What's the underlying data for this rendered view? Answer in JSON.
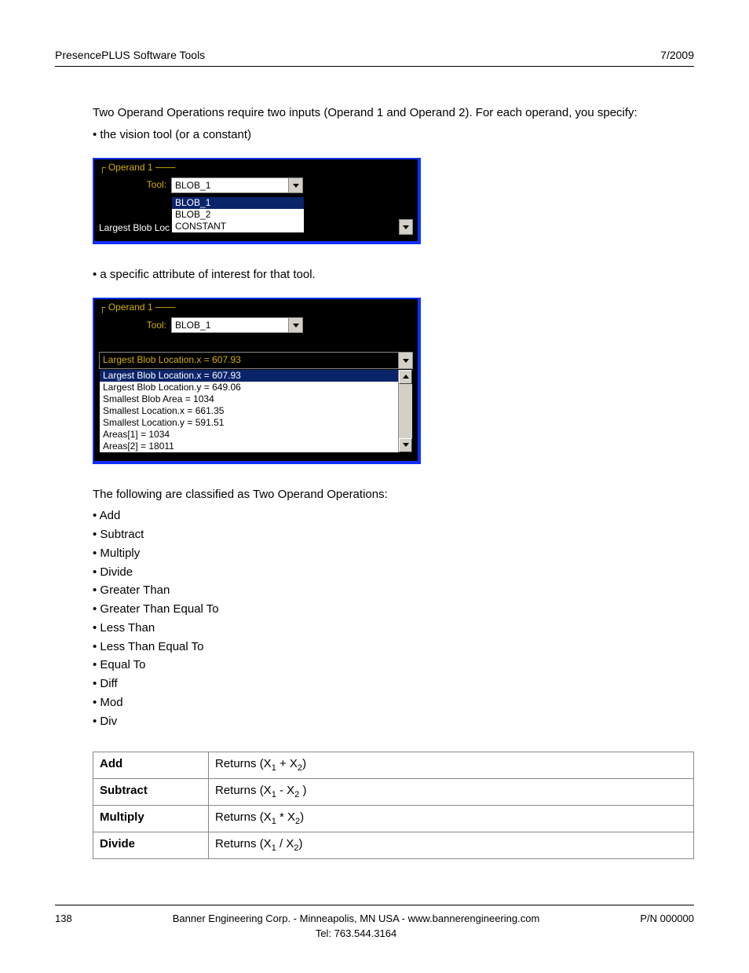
{
  "header": {
    "left": "PresencePLUS Software Tools",
    "right": "7/2009"
  },
  "intro": "Two Operand Operations require two inputs (Operand 1 and Operand 2). For each operand, you specify:",
  "bullet1": "• the vision tool (or a constant)",
  "panel1": {
    "legend": "Operand 1",
    "tool_label": "Tool:",
    "tool_value": "BLOB_1",
    "options": [
      "BLOB_1",
      "BLOB_2",
      "CONSTANT"
    ],
    "truncated": "Largest Blob Loc"
  },
  "bullet2": "• a specific attribute of interest for that tool.",
  "panel2": {
    "legend": "Operand 1",
    "tool_label": "Tool:",
    "tool_value": "BLOB_1",
    "attr_selected": "Largest Blob Location.x = 607.93",
    "attrs": [
      "Largest Blob Location.x = 607.93",
      "Largest Blob Location.y = 649.06",
      "Smallest Blob Area = 1034",
      "Smallest Location.x = 661.35",
      "Smallest Location.y = 591.51",
      "Areas[1] = 1034",
      "Areas[2] = 18011"
    ]
  },
  "classified_intro": "The following are classified as Two Operand Operations:",
  "ops_bullets": [
    "• Add",
    "• Subtract",
    "• Multiply",
    "• Divide",
    "• Greater Than",
    "• Greater Than Equal To",
    "• Less Than",
    "• Less Than Equal To",
    "• Equal To",
    "• Diff",
    "• Mod",
    "• Div"
  ],
  "table": [
    {
      "name": "Add",
      "desc_pre": "Returns (X",
      "s1": "1",
      "mid": " + X",
      "s2": "2",
      "desc_post": ")"
    },
    {
      "name": "Subtract",
      "desc_pre": "Returns (X",
      "s1": "1",
      "mid": " - X",
      "s2": "2",
      "desc_post": " )"
    },
    {
      "name": "Multiply",
      "desc_pre": "Returns (X",
      "s1": "1",
      "mid": " * X",
      "s2": "2",
      "desc_post": ")"
    },
    {
      "name": "Divide",
      "desc_pre": "Returns (X",
      "s1": "1",
      "mid": " / X",
      "s2": "2",
      "desc_post": ")"
    }
  ],
  "footer": {
    "page": "138",
    "center1": "Banner Engineering Corp. - Minneapolis, MN USA - www.bannerengineering.com",
    "center2": "Tel: 763.544.3164",
    "right": "P/N 000000"
  }
}
